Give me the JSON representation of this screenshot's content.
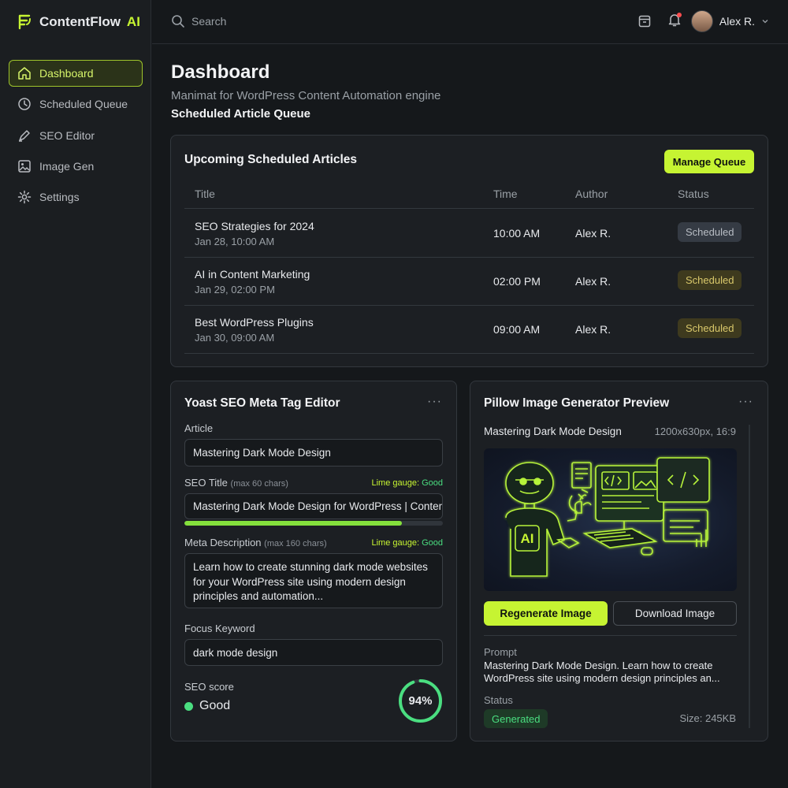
{
  "brand": {
    "name": "ContentFlow",
    "accent": "AI"
  },
  "sidebar": {
    "items": [
      {
        "label": "Dashboard",
        "icon": "home-icon",
        "active": true
      },
      {
        "label": "Scheduled Queue",
        "icon": "clock-icon"
      },
      {
        "label": "SEO Editor",
        "icon": "pen-icon"
      },
      {
        "label": "Image Gen",
        "icon": "image-icon"
      },
      {
        "label": "Settings",
        "icon": "gear-icon"
      }
    ]
  },
  "topbar": {
    "search_placeholder": "Search",
    "user_name": "Alex R."
  },
  "page": {
    "title": "Dashboard",
    "subtitle": "Manimat for WordPress Content Automation engine",
    "section": "Scheduled Article Queue"
  },
  "queue": {
    "title": "Upcoming Scheduled Articles",
    "manage_label": "Manage Queue",
    "columns": [
      "Title",
      "Time",
      "Author",
      "Status"
    ],
    "rows": [
      {
        "title": "SEO Strategies for 2024",
        "date": "Jan 28, 10:00 AM",
        "time": "10:00 AM",
        "author": "Alex R.",
        "status": "Scheduled",
        "style": "gray"
      },
      {
        "title": "AI in Content Marketing",
        "date": "Jan 29, 02:00 PM",
        "time": "02:00 PM",
        "author": "Alex R.",
        "status": "Scheduled",
        "style": "amber"
      },
      {
        "title": "Best WordPress Plugins",
        "date": "Jan 30, 09:00 AM",
        "time": "09:00 AM",
        "author": "Alex R.",
        "status": "Scheduled",
        "style": "amber"
      }
    ]
  },
  "seo": {
    "title": "Yoast SEO Meta Tag Editor",
    "menu": "···",
    "article_label": "Article",
    "article_value": "Mastering Dark Mode Design",
    "seo_title_label": "SEO Title",
    "seo_title_hint": "(max 60 chars)",
    "gauge_prefix": "Lime gauge:",
    "gauge_value": "Good",
    "seo_title_value": "Mastering Dark Mode Design for WordPress | Content",
    "seo_title_progress": 0.84,
    "meta_label": "Meta Description",
    "meta_hint": "(max 160 chars)",
    "meta_value": "Learn how to create stunning dark mode websites for your WordPress site using modern design principles and automation...",
    "keyword_label": "Focus Keyword",
    "keyword_value": "dark mode design",
    "score_label": "SEO score",
    "score_status": "Good",
    "score_percent": "94%",
    "score_value": 0.94
  },
  "pillow": {
    "title": "Pillow Image Generator Preview",
    "menu": "···",
    "article": "Mastering Dark Mode Design",
    "dimensions": "1200x630px, 16:9",
    "regen_label": "Regenerate Image",
    "download_label": "Download Image",
    "prompt_label": "Prompt",
    "prompt_text": "Mastering Dark Mode Design. Learn how to create WordPress site using modern design principles an...",
    "status_label": "Status",
    "status_value": "Generated",
    "size": "Size: 245KB",
    "preview_text": "AI"
  },
  "colors": {
    "accent": "#c6f432",
    "good": "#4ade80",
    "bg": "#15181b",
    "card": "#1c1f23"
  }
}
